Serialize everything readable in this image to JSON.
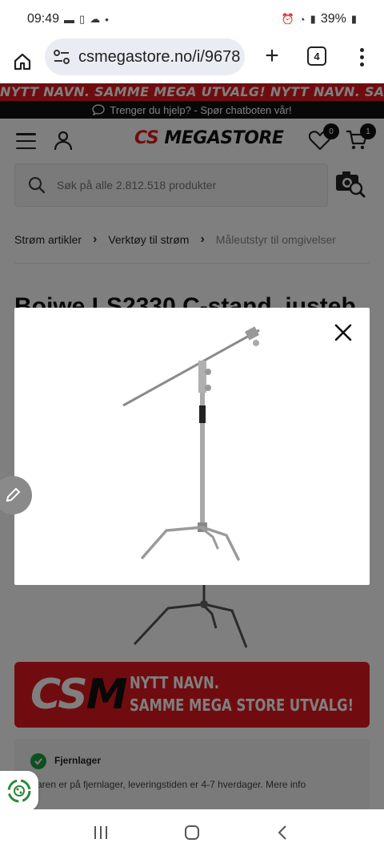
{
  "status_bar": {
    "time": "09:49",
    "battery": "39%"
  },
  "browser": {
    "url": "csmegastore.no/i/9678",
    "tab_count": "4"
  },
  "promo_banner": {
    "text": "NYTT NAVN. SAMME MEGA UTVALG!   NYTT NAVN. SAMME MEGA UTVALG!"
  },
  "help_bar": {
    "text": "Trenger du hjelp? - Spør chatboten vår!"
  },
  "header": {
    "logo_cs": "CS",
    "logo_megastore": "MEGASTORE",
    "wishlist_count": "0",
    "cart_count": "1"
  },
  "search": {
    "placeholder": "Søk på alle 2.812.518 produkter"
  },
  "breadcrumb": [
    {
      "label": "Strøm artikler"
    },
    {
      "label": "Verktøy til strøm"
    },
    {
      "label": "Måleutstyr til omgivelser"
    }
  ],
  "product": {
    "title": "Bojwe LS2330 C-stand, justeb"
  },
  "banner": {
    "logo_cs": "CS",
    "logo_m": "M",
    "line1": "NYTT NAVN.",
    "line2": "SAMME MEGA STORE UTVALG!"
  },
  "stock": {
    "title": "Fjernlager",
    "info": "aren er på fjernlager, leveringstiden er 4-7 hverdager. Mere info"
  },
  "colors": {
    "brand_red": "#e0181f",
    "stock_green": "#1e9e3e"
  }
}
